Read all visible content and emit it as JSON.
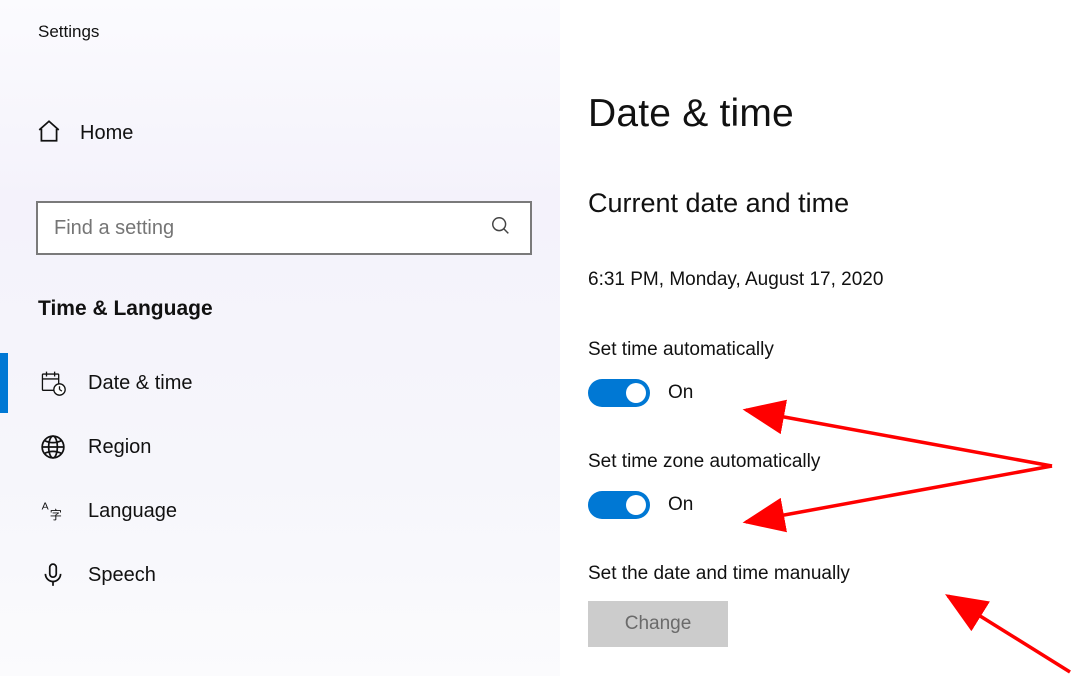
{
  "app_title": "Settings",
  "sidebar": {
    "home_label": "Home",
    "search_placeholder": "Find a setting",
    "category": "Time & Language",
    "items": [
      {
        "label": "Date & time",
        "selected": true
      },
      {
        "label": "Region",
        "selected": false
      },
      {
        "label": "Language",
        "selected": false
      },
      {
        "label": "Speech",
        "selected": false
      }
    ]
  },
  "main": {
    "page_title": "Date & time",
    "section_title": "Current date and time",
    "current_datetime": "6:31 PM, Monday, August 17, 2020",
    "set_time_auto_label": "Set time automatically",
    "set_time_auto_state": "On",
    "set_tz_auto_label": "Set time zone automatically",
    "set_tz_auto_state": "On",
    "manual_label": "Set the date and time manually",
    "change_button": "Change"
  },
  "colors": {
    "accent": "#0078d4",
    "disabled_bg": "#cccccc",
    "arrow": "#ff0000"
  }
}
